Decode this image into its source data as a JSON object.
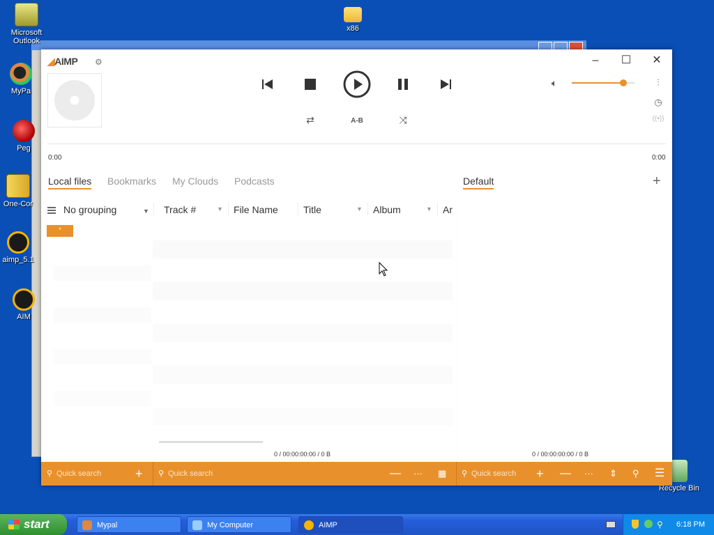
{
  "desktop": {
    "icons": [
      {
        "label": "Microsoft Outlook",
        "icon": "outlook-icon"
      },
      {
        "label": "x86",
        "icon": "folder-icon"
      },
      {
        "label": "MyPa",
        "icon": "mypal-icon"
      },
      {
        "label": "Peg",
        "icon": "peg-icon"
      },
      {
        "label": "One-Cor",
        "icon": "zip-icon"
      },
      {
        "label": "aimp_5.1",
        "icon": "aimp-icon"
      },
      {
        "label": "AIM",
        "icon": "aimp-icon"
      },
      {
        "label": "Recycle Bin",
        "icon": "recycle-bin-icon"
      }
    ]
  },
  "aimp": {
    "logo": "AIMP",
    "controls": {
      "ab_label": "A-B"
    },
    "volume": 0.82,
    "time_current": "0:00",
    "time_total": "0:00",
    "tabs": [
      "Local files",
      "Bookmarks",
      "My Clouds",
      "Podcasts"
    ],
    "playlist_tab": "Default",
    "grouping_label": "No grouping",
    "columns": [
      "Track #",
      "File Name",
      "Title",
      "Album",
      "Ar"
    ],
    "badge": "*",
    "status_left": "0 / 00:00:00:00 / 0 B",
    "status_right": "0 / 00:00:00:00 / 0 B",
    "quick_search_1": "Quick search",
    "quick_search_2": "Quick search",
    "quick_search_3": "Quick search",
    "accent_color": "#e8912c"
  },
  "taskbar": {
    "start_label": "start",
    "tasks": [
      "Mypal",
      "My Computer",
      "AIMP"
    ],
    "active_task": "AIMP",
    "clock": "6:18 PM"
  }
}
